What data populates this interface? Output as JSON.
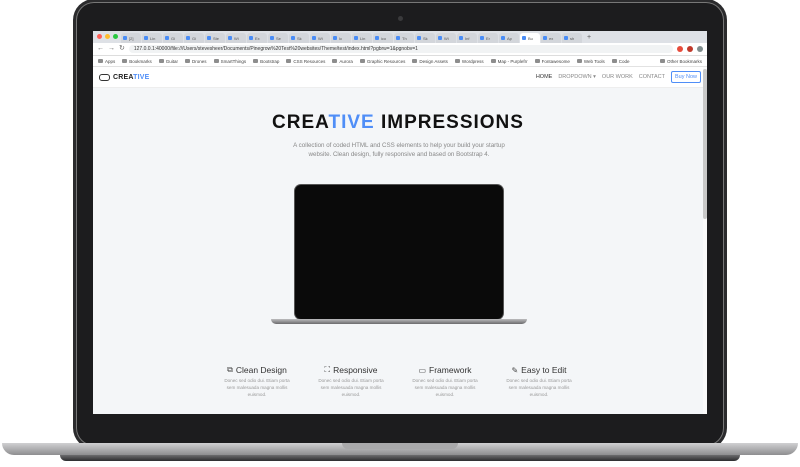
{
  "browser": {
    "tabs": [
      "[2]",
      "Lin",
      "Gi",
      "Gi",
      "Ste",
      "Wi",
      "Ex",
      "Se",
      "Sk",
      "Wi",
      "Ic",
      "Lin",
      "ico",
      "Th",
      "Sk",
      "Wi",
      "Inf",
      "Er",
      "Ap",
      "Bu",
      "ex",
      "sh"
    ],
    "new_tab": "+",
    "url": "127.0.0.1:40000/file:///Users/stevesheer/Documents/Pinegrow%20Test%20websites/Theme/test/index.html?pgbrw=1&pgnobv=1",
    "bookmarks": [
      "Apps",
      "Bookmarks",
      "Guitar",
      "Drones",
      "SmartThings",
      "Bootstrap",
      "CSS Resources",
      "Aurora",
      "Graphic Resources",
      "Design Assets",
      "Wordpress",
      "Map - Purplefrr",
      "Fontawesome",
      "Web Tools",
      "Code"
    ],
    "other_bookmarks": "Other Bookmarks"
  },
  "site": {
    "brand_a": "CREA",
    "brand_b": "TIVE",
    "menu": {
      "home": "HOME",
      "dropdown": "DROPDOWN ▾",
      "work": "OUR WORK",
      "contact": "CONTACT",
      "buy": "Buy Now"
    },
    "hero": {
      "title_a": "CREA",
      "title_b": "TIVE",
      "title_c": " IMPRESSIONS",
      "subtitle": "A collection of coded HTML and CSS elements to help your build your startup website. Clean design, fully responsive and based on Bootstrap 4."
    },
    "features": [
      {
        "icon": "⧉",
        "title": "Clean Design",
        "text": "Donec sed odio dui. Etiam porta sem malesuada magna mollis euismod."
      },
      {
        "icon": "⛶",
        "title": "Responsive",
        "text": "Donec sed odio dui. Etiam porta sem malesuada magna mollis euismod."
      },
      {
        "icon": "▭",
        "title": "Framework",
        "text": "Donec sed odio dui. Etiam porta sem malesuada magna mollis euismod."
      },
      {
        "icon": "✎",
        "title": "Easy to Edit",
        "text": "Donec sed odio dui. Etiam porta sem malesuada magna mollis euismod."
      }
    ]
  },
  "colors": {
    "accent": "#4f8ef7",
    "traffic": [
      "#ff5f57",
      "#ffbd2e",
      "#28c840"
    ],
    "extensions": [
      "#e74c3c",
      "#c0392b",
      "#7f8c8d"
    ]
  }
}
